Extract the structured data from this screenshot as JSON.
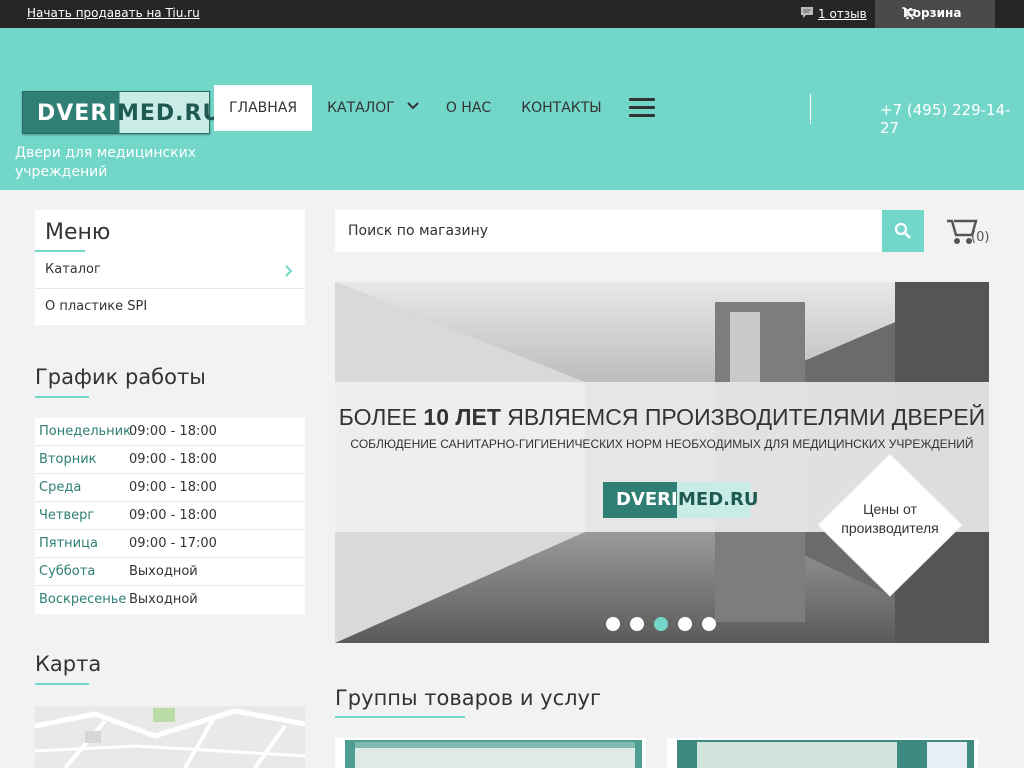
{
  "topbar": {
    "sell_link": "Начать продавать на Tiu.ru",
    "reviews": "1 отзыв",
    "cart": "Корзина"
  },
  "header": {
    "logo_part1": "DVERI",
    "logo_part2": "MED.RU",
    "tagline": "Двери для медицинских учреждений",
    "nav": [
      "ГЛАВНАЯ",
      "КАТАЛОГ",
      "О НАС",
      "КОНТАКТЫ"
    ],
    "phone": "+7 (495) 229-14-27"
  },
  "sidebar": {
    "menu_title": "Меню",
    "menu_items": [
      "Каталог",
      "О пластике SPI"
    ],
    "schedule_title": "График работы",
    "schedule": [
      {
        "day": "Понедельник",
        "time": "09:00 - 18:00"
      },
      {
        "day": "Вторник",
        "time": "09:00 - 18:00"
      },
      {
        "day": "Среда",
        "time": "09:00 - 18:00"
      },
      {
        "day": "Четверг",
        "time": "09:00 - 18:00"
      },
      {
        "day": "Пятница",
        "time": "09:00 - 17:00"
      },
      {
        "day": "Суббота",
        "time": "Выходной"
      },
      {
        "day": "Воскресенье",
        "time": "Выходной"
      }
    ],
    "map_title": "Карта"
  },
  "search": {
    "placeholder": "Поиск по магазину"
  },
  "cart_count": "(0)",
  "banner": {
    "headline_a": "БОЛЕЕ ",
    "headline_b": "10 ЛЕТ",
    "headline_c": " ЯВЛЯЕМСЯ ПРОИЗВОДИТЕЛЯМИ ДВЕРЕЙ",
    "subline": "СОБЛЮДЕНИЕ САНИТАРНО-ГИГИЕНИЧЕСКИХ НОРМ НЕОБХОДИМЫХ ДЛЯ МЕДИЦИНСКИХ УЧРЕЖДЕНИЙ",
    "logo_part1": "DVERI",
    "logo_part2": "MED.RU",
    "badge_line1": "Цены от",
    "badge_line2": "производителя",
    "slides": 5,
    "active_slide": 3
  },
  "groups_title": "Группы товаров и услуг",
  "colors": {
    "accent": "#72d6c9",
    "dark": "#262626",
    "brand_dark": "#2f7f74"
  }
}
